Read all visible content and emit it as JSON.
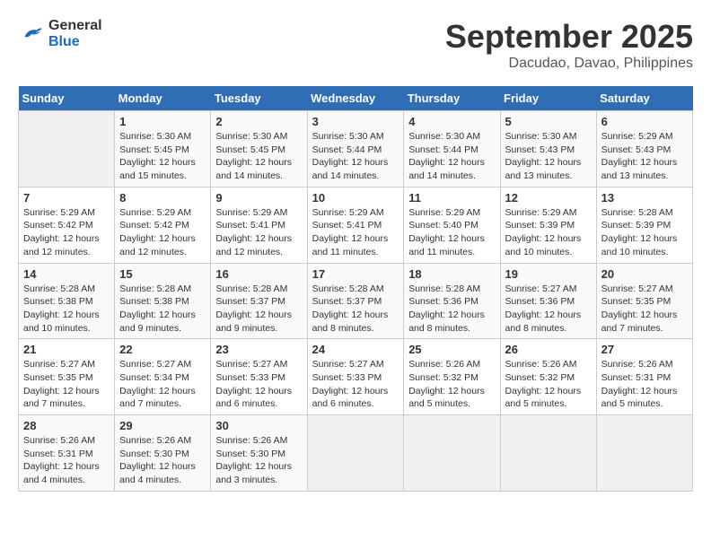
{
  "logo": {
    "line1": "General",
    "line2": "Blue"
  },
  "title": "September 2025",
  "location": "Dacudao, Davao, Philippines",
  "days_of_week": [
    "Sunday",
    "Monday",
    "Tuesday",
    "Wednesday",
    "Thursday",
    "Friday",
    "Saturday"
  ],
  "weeks": [
    [
      {
        "num": "",
        "info": ""
      },
      {
        "num": "1",
        "info": "Sunrise: 5:30 AM\nSunset: 5:45 PM\nDaylight: 12 hours\nand 15 minutes."
      },
      {
        "num": "2",
        "info": "Sunrise: 5:30 AM\nSunset: 5:45 PM\nDaylight: 12 hours\nand 14 minutes."
      },
      {
        "num": "3",
        "info": "Sunrise: 5:30 AM\nSunset: 5:44 PM\nDaylight: 12 hours\nand 14 minutes."
      },
      {
        "num": "4",
        "info": "Sunrise: 5:30 AM\nSunset: 5:44 PM\nDaylight: 12 hours\nand 14 minutes."
      },
      {
        "num": "5",
        "info": "Sunrise: 5:30 AM\nSunset: 5:43 PM\nDaylight: 12 hours\nand 13 minutes."
      },
      {
        "num": "6",
        "info": "Sunrise: 5:29 AM\nSunset: 5:43 PM\nDaylight: 12 hours\nand 13 minutes."
      }
    ],
    [
      {
        "num": "7",
        "info": "Sunrise: 5:29 AM\nSunset: 5:42 PM\nDaylight: 12 hours\nand 12 minutes."
      },
      {
        "num": "8",
        "info": "Sunrise: 5:29 AM\nSunset: 5:42 PM\nDaylight: 12 hours\nand 12 minutes."
      },
      {
        "num": "9",
        "info": "Sunrise: 5:29 AM\nSunset: 5:41 PM\nDaylight: 12 hours\nand 12 minutes."
      },
      {
        "num": "10",
        "info": "Sunrise: 5:29 AM\nSunset: 5:41 PM\nDaylight: 12 hours\nand 11 minutes."
      },
      {
        "num": "11",
        "info": "Sunrise: 5:29 AM\nSunset: 5:40 PM\nDaylight: 12 hours\nand 11 minutes."
      },
      {
        "num": "12",
        "info": "Sunrise: 5:29 AM\nSunset: 5:39 PM\nDaylight: 12 hours\nand 10 minutes."
      },
      {
        "num": "13",
        "info": "Sunrise: 5:28 AM\nSunset: 5:39 PM\nDaylight: 12 hours\nand 10 minutes."
      }
    ],
    [
      {
        "num": "14",
        "info": "Sunrise: 5:28 AM\nSunset: 5:38 PM\nDaylight: 12 hours\nand 10 minutes."
      },
      {
        "num": "15",
        "info": "Sunrise: 5:28 AM\nSunset: 5:38 PM\nDaylight: 12 hours\nand 9 minutes."
      },
      {
        "num": "16",
        "info": "Sunrise: 5:28 AM\nSunset: 5:37 PM\nDaylight: 12 hours\nand 9 minutes."
      },
      {
        "num": "17",
        "info": "Sunrise: 5:28 AM\nSunset: 5:37 PM\nDaylight: 12 hours\nand 8 minutes."
      },
      {
        "num": "18",
        "info": "Sunrise: 5:28 AM\nSunset: 5:36 PM\nDaylight: 12 hours\nand 8 minutes."
      },
      {
        "num": "19",
        "info": "Sunrise: 5:27 AM\nSunset: 5:36 PM\nDaylight: 12 hours\nand 8 minutes."
      },
      {
        "num": "20",
        "info": "Sunrise: 5:27 AM\nSunset: 5:35 PM\nDaylight: 12 hours\nand 7 minutes."
      }
    ],
    [
      {
        "num": "21",
        "info": "Sunrise: 5:27 AM\nSunset: 5:35 PM\nDaylight: 12 hours\nand 7 minutes."
      },
      {
        "num": "22",
        "info": "Sunrise: 5:27 AM\nSunset: 5:34 PM\nDaylight: 12 hours\nand 7 minutes."
      },
      {
        "num": "23",
        "info": "Sunrise: 5:27 AM\nSunset: 5:33 PM\nDaylight: 12 hours\nand 6 minutes."
      },
      {
        "num": "24",
        "info": "Sunrise: 5:27 AM\nSunset: 5:33 PM\nDaylight: 12 hours\nand 6 minutes."
      },
      {
        "num": "25",
        "info": "Sunrise: 5:26 AM\nSunset: 5:32 PM\nDaylight: 12 hours\nand 5 minutes."
      },
      {
        "num": "26",
        "info": "Sunrise: 5:26 AM\nSunset: 5:32 PM\nDaylight: 12 hours\nand 5 minutes."
      },
      {
        "num": "27",
        "info": "Sunrise: 5:26 AM\nSunset: 5:31 PM\nDaylight: 12 hours\nand 5 minutes."
      }
    ],
    [
      {
        "num": "28",
        "info": "Sunrise: 5:26 AM\nSunset: 5:31 PM\nDaylight: 12 hours\nand 4 minutes."
      },
      {
        "num": "29",
        "info": "Sunrise: 5:26 AM\nSunset: 5:30 PM\nDaylight: 12 hours\nand 4 minutes."
      },
      {
        "num": "30",
        "info": "Sunrise: 5:26 AM\nSunset: 5:30 PM\nDaylight: 12 hours\nand 3 minutes."
      },
      {
        "num": "",
        "info": ""
      },
      {
        "num": "",
        "info": ""
      },
      {
        "num": "",
        "info": ""
      },
      {
        "num": "",
        "info": ""
      }
    ]
  ]
}
